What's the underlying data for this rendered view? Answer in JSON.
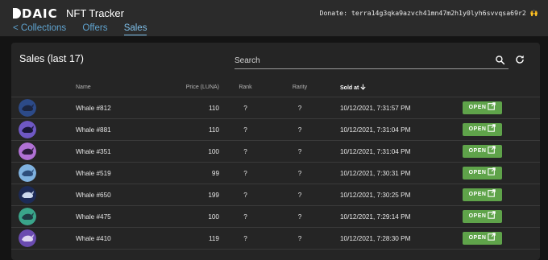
{
  "header": {
    "logo": "DAIC",
    "app_title": "NFT Tracker",
    "donate_label": "Donate:",
    "donate_address": "terra14g3qka9azvch41mn47m2h1y0lyh6svvqsa69r2",
    "donate_emoji": "🙌",
    "nav": [
      {
        "label": "< Collections",
        "active": false
      },
      {
        "label": "Offers",
        "active": false
      },
      {
        "label": "Sales",
        "active": true
      }
    ]
  },
  "panel": {
    "title": "Sales (last 17)",
    "search_placeholder": "Search"
  },
  "table": {
    "columns": {
      "name": "Name",
      "price": "Price (LUNA)",
      "rank": "Rank",
      "rarity": "Rarity",
      "sold_at": "Sold at"
    },
    "rows": [
      {
        "name": "Whale #812",
        "price": "110",
        "rank": "?",
        "rarity": "?",
        "sold_at": "10/12/2021, 7:31:57 PM",
        "action": "OPEN",
        "bg": "#2c4a88",
        "fg": "#1b2540"
      },
      {
        "name": "Whale #881",
        "price": "110",
        "rank": "?",
        "rarity": "?",
        "sold_at": "10/12/2021, 7:31:04 PM",
        "action": "OPEN",
        "bg": "#6f58c4",
        "fg": "#1a1738"
      },
      {
        "name": "Whale #351",
        "price": "100",
        "rank": "?",
        "rarity": "?",
        "sold_at": "10/12/2021, 7:31:04 PM",
        "action": "OPEN",
        "bg": "#b071d4",
        "fg": "#2c1c3c"
      },
      {
        "name": "Whale #519",
        "price": "99",
        "rank": "?",
        "rarity": "?",
        "sold_at": "10/12/2021, 7:30:31 PM",
        "action": "OPEN",
        "bg": "#7fb2e0",
        "fg": "#2d4e7c"
      },
      {
        "name": "Whale #650",
        "price": "199",
        "rank": "?",
        "rarity": "?",
        "sold_at": "10/12/2021, 7:30:25 PM",
        "action": "OPEN",
        "bg": "#1c2a56",
        "fg": "#cdd9ee"
      },
      {
        "name": "Whale #475",
        "price": "100",
        "rank": "?",
        "rarity": "?",
        "sold_at": "10/12/2021, 7:29:14 PM",
        "action": "OPEN",
        "bg": "#3aa58a",
        "fg": "#1f3b43"
      },
      {
        "name": "Whale #410",
        "price": "119",
        "rank": "?",
        "rarity": "?",
        "sold_at": "10/12/2021, 7:28:30 PM",
        "action": "OPEN",
        "bg": "#6a4bb0",
        "fg": "#ddd6f0"
      }
    ]
  },
  "colors": {
    "accent_link": "#5fa3cf",
    "open_button": "#5fa34a"
  }
}
